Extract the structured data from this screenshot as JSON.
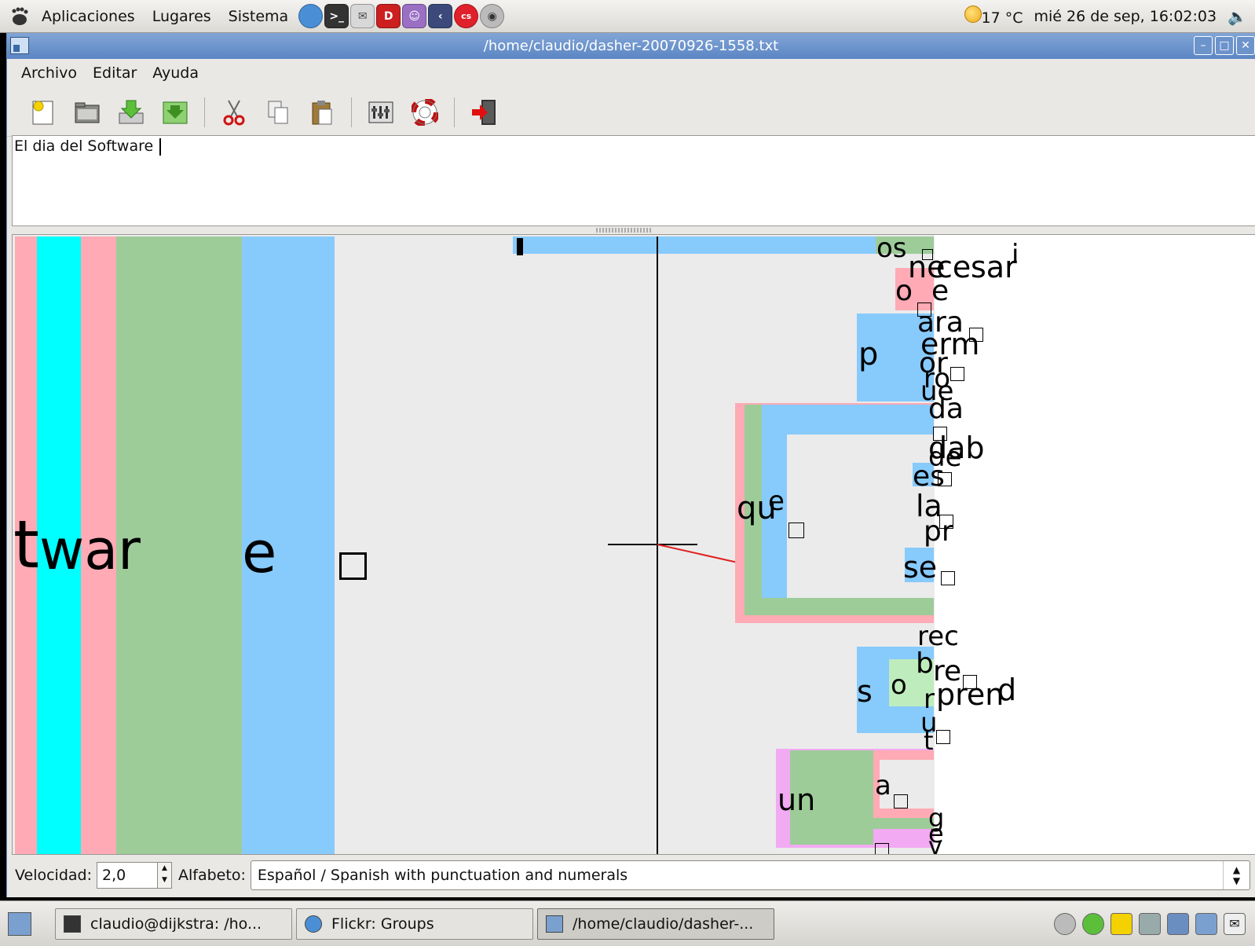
{
  "top_panel": {
    "menus": [
      "Aplicaciones",
      "Lugares",
      "Sistema"
    ],
    "launchers": [
      {
        "icon": "globe-icon",
        "color": "#4a8fd6"
      },
      {
        "icon": "terminal-icon",
        "color": "#333333"
      },
      {
        "icon": "mail-icon",
        "color": "#c8c8c8"
      },
      {
        "icon": "pdf-reader-icon",
        "color": "#cc1f1f"
      },
      {
        "icon": "pidgin-icon",
        "color": "#9b6fc4"
      },
      {
        "icon": "ekiga-icon",
        "color": "#3b4a7a"
      },
      {
        "icon": "lastfm-icon",
        "color": "#e0202a"
      },
      {
        "icon": "cd-icon",
        "color": "#bbbbbb"
      }
    ],
    "weather": "17 °C",
    "clock": "mié 26 de sep, 16:02:03"
  },
  "window": {
    "title": "/home/claudio/dasher-20070926-1558.txt",
    "menu": [
      "Archivo",
      "Editar",
      "Ayuda"
    ],
    "toolbar_icons": [
      "new-file-icon",
      "open-folder-icon",
      "save-icon",
      "save-as-icon",
      "cut-icon",
      "copy-icon",
      "paste-icon",
      "preferences-icon",
      "help-icon",
      "quit-icon"
    ],
    "editor_text": "El dia del Software "
  },
  "canvas": {
    "big_letters": [
      "t",
      "war",
      "e"
    ],
    "tree_labels": [
      "os",
      "ne",
      "ce",
      "sar",
      "i",
      "o",
      "e",
      "p",
      "ara",
      "erm",
      "or",
      "ro",
      "ue",
      "da",
      "qu",
      "e",
      "dab",
      "de",
      "es",
      "la",
      "pr",
      "se",
      "rec",
      "b",
      "re",
      "s",
      "o",
      "r",
      "pren",
      "d",
      "u",
      "t",
      "un",
      "a",
      "g",
      "e",
      "v"
    ]
  },
  "controls": {
    "speed_label": "Velocidad:",
    "speed_value": "2,0",
    "alphabet_label": "Alfabeto:",
    "alphabet_value": "Español / Spanish with punctuation and numerals"
  },
  "taskbar": {
    "tasks": [
      {
        "label": "claudio@dijkstra: /ho...",
        "icon": "terminal-icon"
      },
      {
        "label": "Flickr: Groups",
        "icon": "browser-icon"
      },
      {
        "label": "/home/claudio/dasher-...",
        "icon": "dasher-icon"
      }
    ]
  }
}
